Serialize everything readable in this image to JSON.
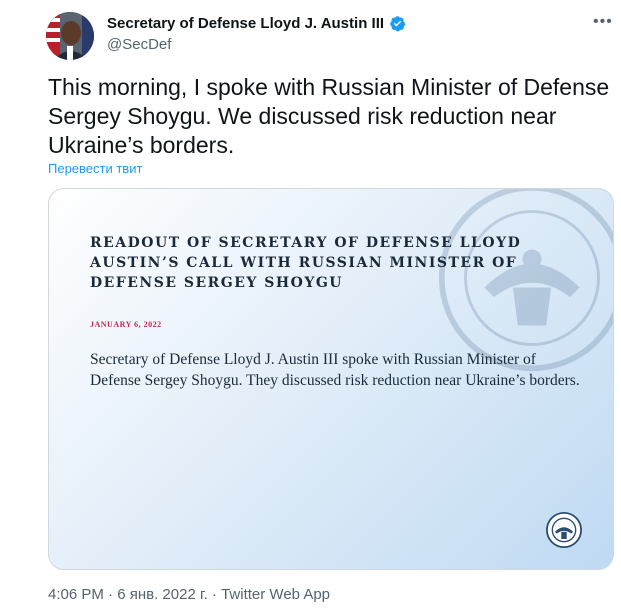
{
  "author": {
    "name": "Secretary of Defense Lloyd J. Austin III",
    "handle": "@SecDef",
    "verified_icon": "verified-badge-icon"
  },
  "tweet": {
    "text": "This morning, I spoke with Russian Minister of Defense Sergey Shoygu. We discussed risk reduction near Ukraine’s borders.",
    "translate_link": "Перевести твит",
    "more_icon": "more-icon"
  },
  "card": {
    "title": "READOUT OF SECRETARY OF DEFENSE LLOYD AUSTIN’S CALL WITH RUSSIAN MINISTER OF DEFENSE SERGEY SHOYGU",
    "date": "JANUARY 6, 2022",
    "body": "Secretary of Defense Lloyd J. Austin III spoke with Russian Minister of Defense Sergey Shoygu.  They discussed risk reduction near Ukraine’s borders.",
    "seal_icon": "department-of-defense-seal-icon"
  },
  "meta": {
    "line": "4:06 PM · 6 янв. 2022 г. · Twitter Web App"
  },
  "colors": {
    "accent": "#1d9bf0",
    "text": "#0f1419",
    "muted": "#536471",
    "date_red": "#c02a48"
  }
}
